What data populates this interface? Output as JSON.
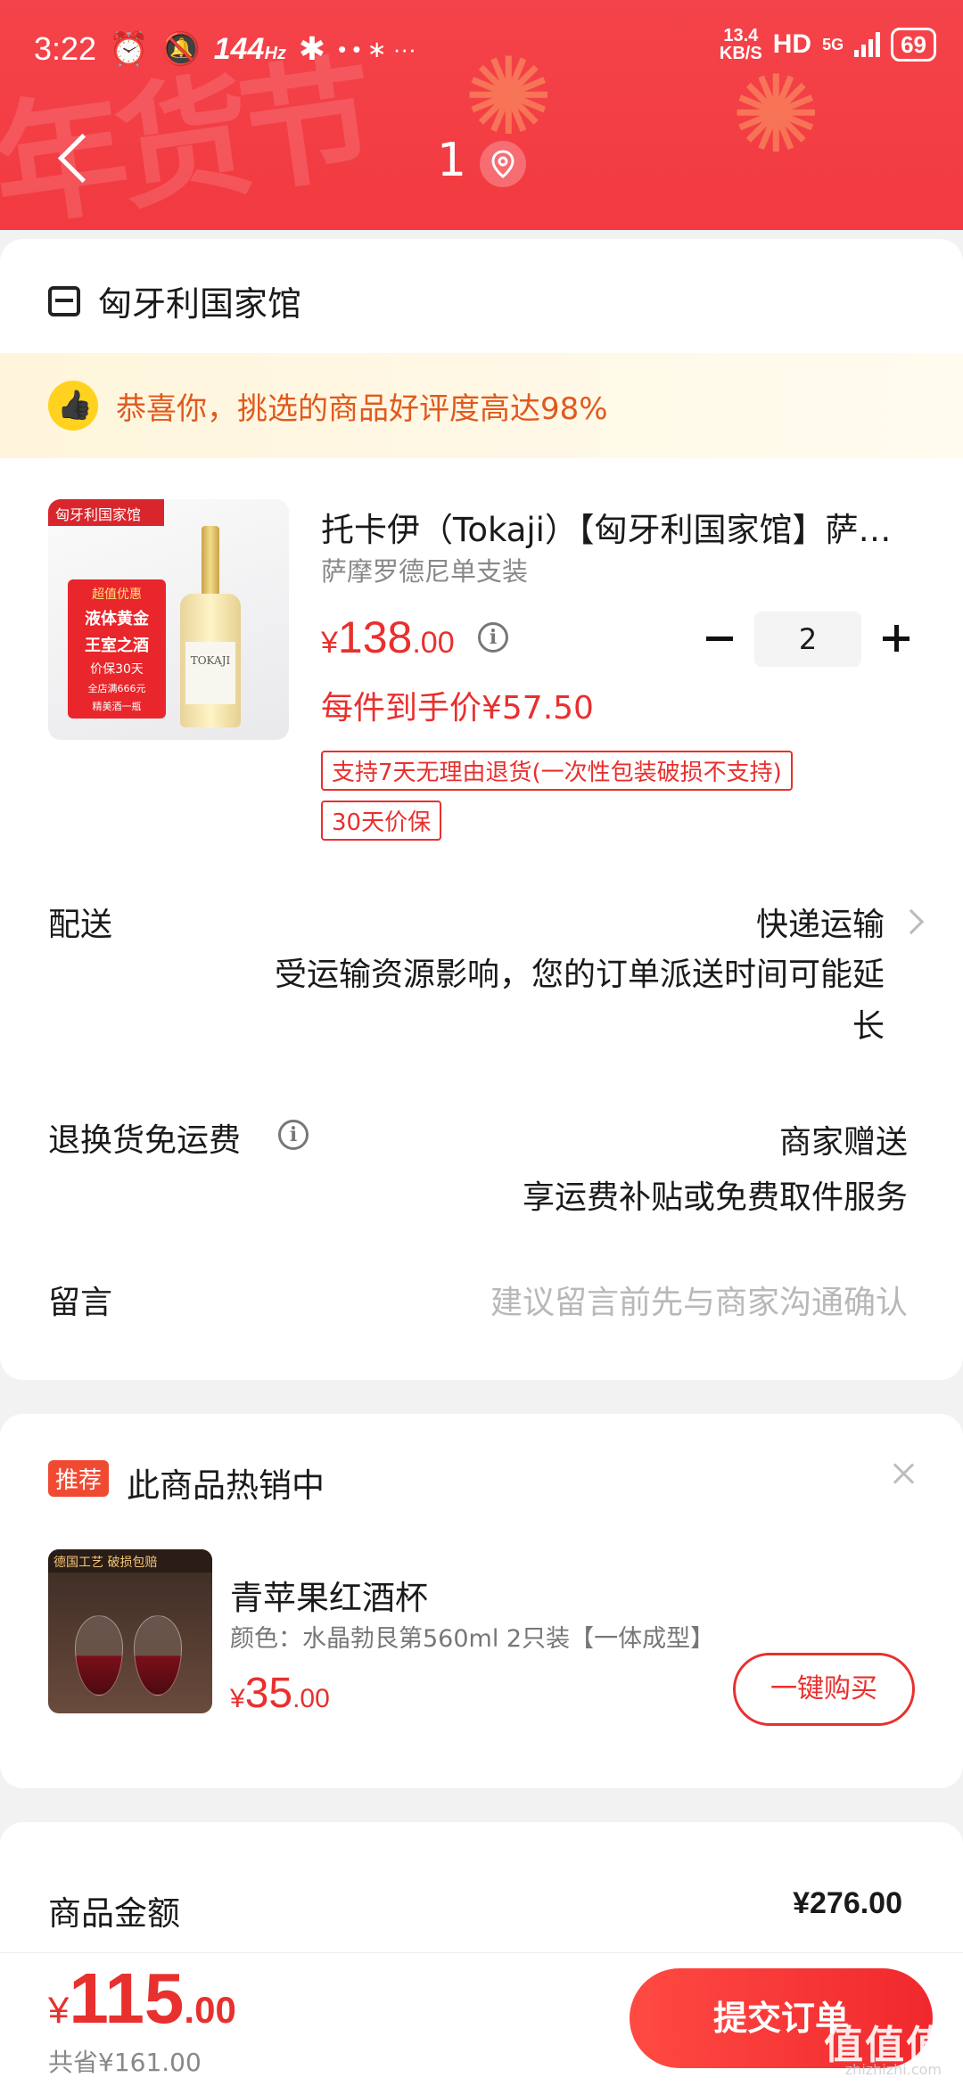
{
  "status_bar": {
    "time": "3:22",
    "refresh_rate": "144",
    "refresh_unit": "Hz",
    "net_speed_value": "13.4",
    "net_speed_unit": "KB/S",
    "hd": "HD",
    "network": "5G",
    "battery": "69"
  },
  "header": {
    "festive_text": "年货节",
    "title": "1"
  },
  "shop": {
    "name": "匈牙利国家馆"
  },
  "praise": {
    "text": "恭喜你，挑选的商品好评度高达98%"
  },
  "product": {
    "image_top_text": "匈牙利国家馆",
    "image_badge_l1": "超值优惠",
    "image_badge_l2": "液体黄金",
    "image_badge_l3": "王室之酒",
    "image_badge_l4": "价保30天",
    "image_badge_l5": "全店满666元",
    "image_badge_l6": "精美酒一瓶",
    "bottle_label": "TOKAJI",
    "title": "托卡伊（Tokaji）【匈牙利国家馆】萨摩罗德尼单支装",
    "spec": "萨摩罗德尼单支装",
    "price_symbol": "¥",
    "price_int": "138",
    "price_dec": ".00",
    "quantity": "2",
    "unit_price_text": "每件到手价¥57.50",
    "tags": [
      "支持7天无理由退货(一次性包装破损不支持)",
      "30天价保"
    ]
  },
  "delivery": {
    "label": "配送",
    "method": "快递运输",
    "note_line1": "受运输资源影响，您的订单派送时间可能延",
    "note_line2": "长"
  },
  "return_shipping": {
    "label": "退换货免运费",
    "value_line1": "商家赠送",
    "value_line2": "享运费补贴或免费取件服务"
  },
  "message": {
    "label": "留言",
    "placeholder": "建议留言前先与商家沟通确认"
  },
  "recommend": {
    "badge": "推荐",
    "title": "此商品热销中",
    "image_strip_text": "德国工艺 破损包赔",
    "name": "青苹果红酒杯",
    "spec": "颜色：水晶勃艮第560ml 2只装【一体成型】",
    "price_symbol": "¥",
    "price_int": "35",
    "price_dec": ".00",
    "buy_label": "一键购买"
  },
  "summary": {
    "goods_amount_label": "商品金额",
    "goods_amount_value": "¥276.00"
  },
  "bottom": {
    "total_symbol": "¥",
    "total_int": "115",
    "total_dec": ".00",
    "saved_text": "共省¥161.00",
    "submit_label": "提交订单",
    "watermark": "值值值",
    "watermark_sub": "zhizhizhi.com"
  },
  "colors": {
    "brand_red": "#e8302e",
    "header_red": "#f4434a",
    "praise_orange": "#e05a1e"
  }
}
